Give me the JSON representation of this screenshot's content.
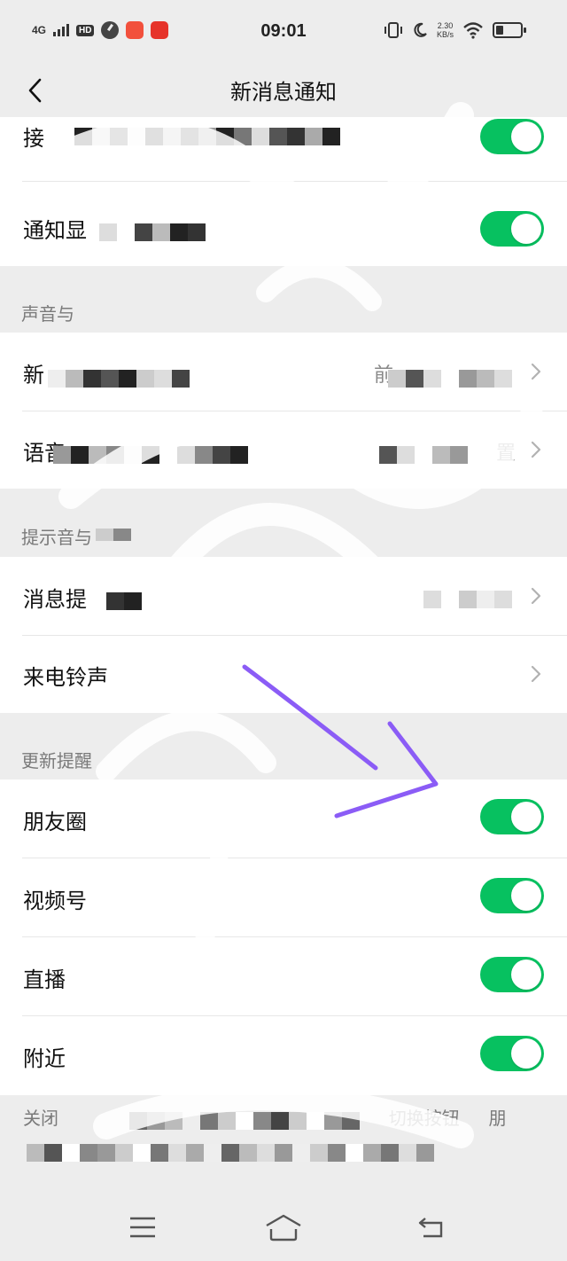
{
  "status_bar": {
    "network": "4G",
    "hd": "HD",
    "time": "09:01",
    "netspeed_value": "2.30",
    "netspeed_unit": "KB/s"
  },
  "nav": {
    "title": "新消息通知",
    "back_icon": "chevron-left-icon"
  },
  "group1": {
    "rows": [
      {
        "label": "接",
        "toggle": true
      },
      {
        "label": "通知显",
        "toggle": true
      }
    ]
  },
  "sound_section": {
    "header": "声音与",
    "rows": [
      {
        "label": "新",
        "value": "前"
      },
      {
        "label": "语音",
        "value": "置"
      }
    ]
  },
  "tone_section": {
    "header": "提示音与",
    "rows": [
      {
        "label": "消息提",
        "value": ""
      },
      {
        "label": "来电铃声",
        "value": ""
      }
    ]
  },
  "update_section": {
    "header": "更新提醒",
    "rows": [
      {
        "label": "朋友圈",
        "toggle": true
      },
      {
        "label": "视频号",
        "toggle": true
      },
      {
        "label": "直播",
        "toggle": true
      },
      {
        "label": "附近",
        "toggle": true
      }
    ]
  },
  "footer": {
    "line1_start": "关闭",
    "line1_mid": "切换按钮",
    "line1_end": "朋"
  },
  "colors": {
    "toggle_on": "#07c160",
    "background": "#ededed",
    "annotation_arrow": "#8b5cf6"
  },
  "system_nav": {
    "menu_icon": "menu-icon",
    "home_icon": "home-icon",
    "back_icon": "back-icon"
  }
}
